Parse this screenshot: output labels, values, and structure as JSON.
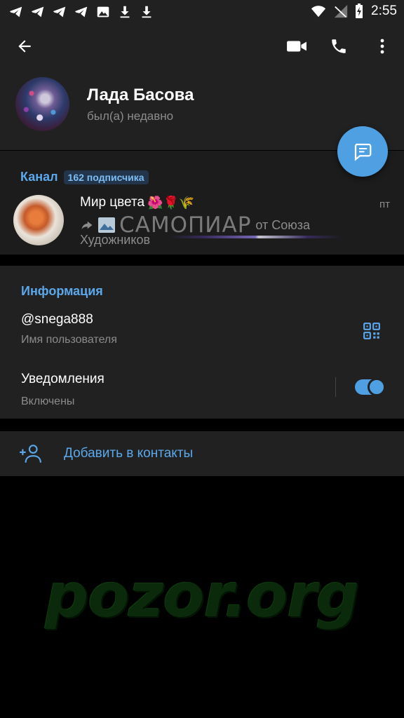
{
  "status_bar": {
    "time": "2:55",
    "left_icons": [
      "telegram-icon",
      "telegram-icon",
      "telegram-icon",
      "telegram-icon",
      "image-icon",
      "download-icon",
      "download-icon"
    ],
    "right_icons": [
      "wifi-icon",
      "no-signal-icon",
      "battery-charging-icon"
    ]
  },
  "header": {
    "name": "Лада Басова",
    "status": "был(а) недавно"
  },
  "channel": {
    "section_title": "Канал",
    "subscribers": "162 подписчика",
    "name": "Мир цвета",
    "emoji": "🌺🌹🌾",
    "time": "пт",
    "brand": "САМОПИАР",
    "from_text": "от Союза",
    "line2": "Художников"
  },
  "info": {
    "title": "Информация",
    "username": "@snega888",
    "username_label": "Имя пользователя",
    "notifications_label": "Уведомления",
    "notifications_state": "Включены",
    "notifications_on": true
  },
  "add_contact": {
    "label": "Добавить в контакты"
  },
  "watermark": "pozor.org",
  "colors": {
    "accent": "#4f9fe3",
    "link": "#5ba8ec",
    "surface": "#212121",
    "background": "#000000"
  }
}
